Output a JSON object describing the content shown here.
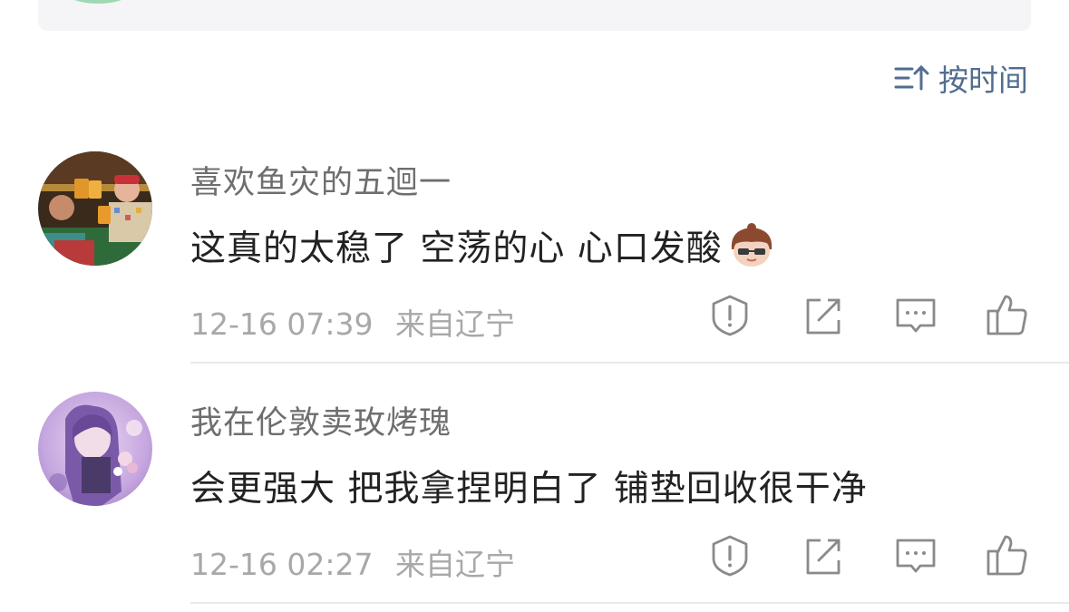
{
  "sort": {
    "label": "按时间",
    "icon": "sort-icon"
  },
  "comments": [
    {
      "username": "喜欢鱼灾的五迴一",
      "content": "这真的太稳了 空荡的心 心口发酸",
      "emoji": "cool-boy-sunglasses-emoji",
      "time": "12-16 07:39",
      "location": "来自辽宁",
      "avatar": "avatar-cheers-photo"
    },
    {
      "username": "我在伦敦卖玫烤瑰",
      "content": "会更强大 把我拿捏明白了 铺垫回收很干净",
      "time": "12-16 02:27",
      "location": "来自辽宁",
      "avatar": "avatar-anime-purple"
    }
  ],
  "actions": [
    "report-icon",
    "share-icon",
    "reply-icon",
    "like-icon"
  ],
  "colors": {
    "link": "#526d90",
    "meta": "#a8a8a8",
    "text": "#222222",
    "icon": "#8a8a8a"
  }
}
